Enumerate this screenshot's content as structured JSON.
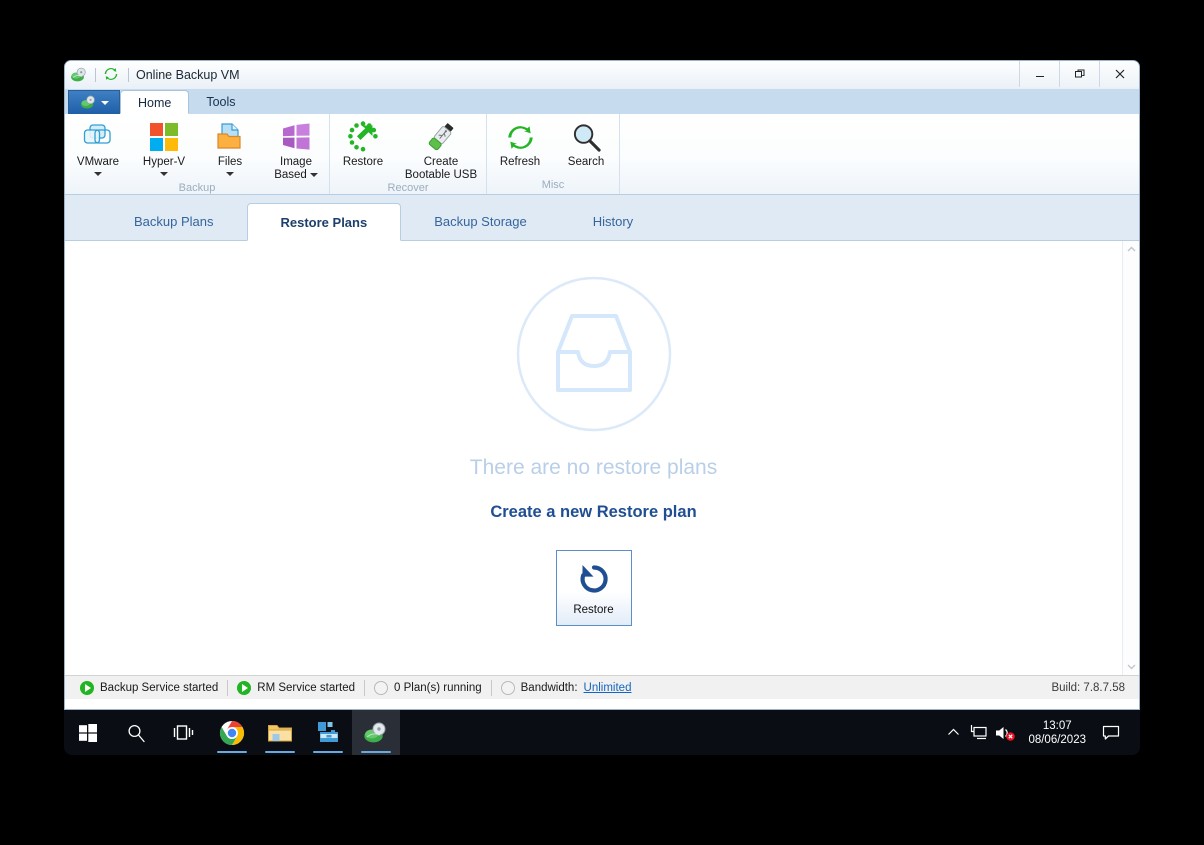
{
  "window": {
    "title": "Online Backup VM",
    "app_icon": "cloud-backup-icon",
    "refresh_icon": "refresh-icon",
    "controls": {
      "minimize": "–",
      "restore": "❐",
      "close": "✕"
    }
  },
  "ribbon": {
    "app_menu_label": "app-menu",
    "tabs": [
      {
        "label": "Home",
        "active": true
      },
      {
        "label": "Tools",
        "active": false
      }
    ],
    "groups": [
      {
        "label": "Backup",
        "buttons": [
          {
            "label": "VMware",
            "icon": "vmware-icon",
            "dropdown": true,
            "caret_inline": false
          },
          {
            "label": "Hyper-V",
            "icon": "hyperv-icon",
            "dropdown": true,
            "caret_inline": false
          },
          {
            "label": "Files",
            "icon": "files-icon",
            "dropdown": true,
            "caret_inline": false
          },
          {
            "label": "Image\nBased",
            "icon": "image-based-icon",
            "dropdown": true,
            "caret_inline": true
          }
        ]
      },
      {
        "label": "Recover",
        "buttons": [
          {
            "label": "Restore",
            "icon": "restore-dotted-icon",
            "dropdown": false,
            "caret_inline": false
          },
          {
            "label": "Create\nBootable USB",
            "icon": "usb-drive-icon",
            "dropdown": false,
            "caret_inline": false
          }
        ]
      },
      {
        "label": "Misc",
        "buttons": [
          {
            "label": "Refresh",
            "icon": "refresh-icon",
            "dropdown": false,
            "caret_inline": false
          },
          {
            "label": "Search",
            "icon": "search-icon",
            "dropdown": false,
            "caret_inline": false
          }
        ]
      }
    ]
  },
  "page_tabs": [
    {
      "label": "Backup Plans",
      "active": false
    },
    {
      "label": "Restore Plans",
      "active": true
    },
    {
      "label": "Backup Storage",
      "active": false
    },
    {
      "label": "History",
      "active": false
    }
  ],
  "content": {
    "empty_icon": "inbox-tray-circle-icon",
    "empty_title": "There are no restore plans",
    "create_link": "Create a new Restore plan",
    "tile": {
      "label": "Restore",
      "icon": "restore-arrow-icon"
    },
    "scrollbar": {
      "up": "scroll-up-arrow",
      "down": "scroll-down-arrow"
    }
  },
  "statusbar": {
    "items": [
      {
        "label": "Backup Service started",
        "indicator": "green-play"
      },
      {
        "label": "RM Service started",
        "indicator": "green-play"
      },
      {
        "label": "0 Plan(s) running",
        "indicator": "gray-circle"
      },
      {
        "label": "Bandwidth:",
        "link": "Unlimited",
        "indicator": "gray-circle"
      }
    ],
    "build": "Build: 7.8.7.58"
  },
  "taskbar": {
    "buttons": [
      {
        "name": "start",
        "icon": "windows-logo-icon",
        "active": false,
        "underline": false
      },
      {
        "name": "search",
        "icon": "search-icon",
        "active": false,
        "underline": false
      },
      {
        "name": "task-view",
        "icon": "task-view-icon",
        "active": false,
        "underline": false
      },
      {
        "name": "chrome",
        "icon": "chrome-icon",
        "active": false,
        "underline": true
      },
      {
        "name": "file-explorer",
        "icon": "folder-icon",
        "active": false,
        "underline": true
      },
      {
        "name": "remote-tool",
        "icon": "toolbox-icon",
        "active": false,
        "underline": true
      },
      {
        "name": "online-backup",
        "icon": "cloud-backup-icon",
        "active": true,
        "underline": true
      }
    ],
    "tray": {
      "chevron": "show-hidden-icons",
      "network": "network-icon",
      "volume": "volume-muted-icon",
      "time": "13:07",
      "date": "08/06/2023",
      "notifications": "notification-icon"
    }
  },
  "colors": {
    "accent": "#1f4e93",
    "tab_text": "#35659c",
    "empty_text": "#b9cfe8",
    "green": "#22b422",
    "taskbar": "#0a0e14"
  }
}
